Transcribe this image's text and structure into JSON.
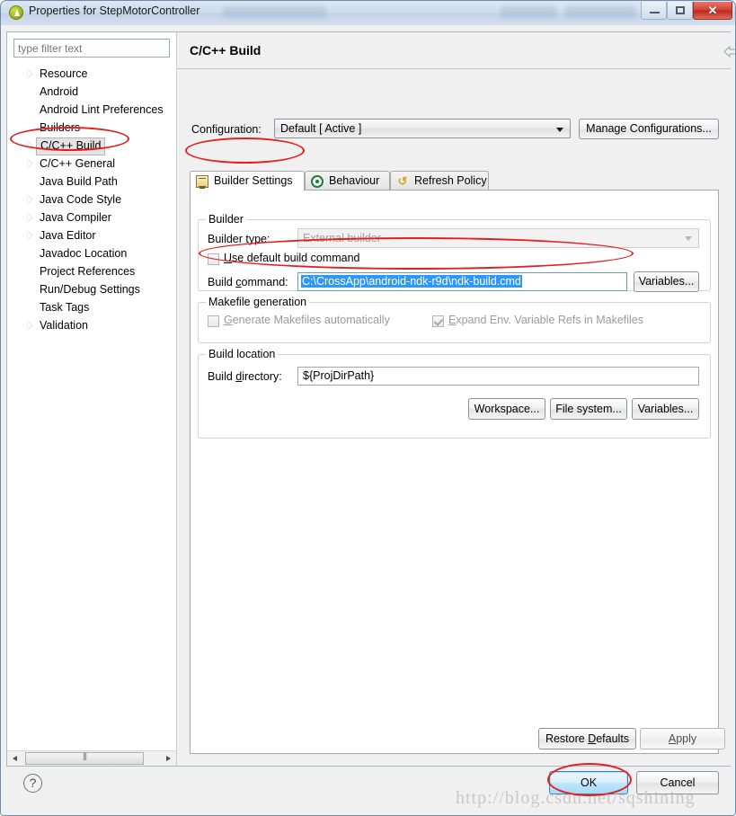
{
  "window": {
    "title": "Properties for StepMotorController",
    "icon": "eclipse-properties-icon",
    "controls": {
      "minimize": "minimize-icon",
      "maximize": "restore-icon",
      "close": "close-icon"
    }
  },
  "sidebar": {
    "filter": {
      "placeholder": "type filter text",
      "value": ""
    },
    "items": [
      {
        "label": "Resource",
        "expandable": true,
        "selected": false
      },
      {
        "label": "Android",
        "expandable": false,
        "selected": false
      },
      {
        "label": "Android Lint Preferences",
        "expandable": false,
        "selected": false
      },
      {
        "label": "Builders",
        "expandable": false,
        "selected": false
      },
      {
        "label": "C/C++ Build",
        "expandable": true,
        "selected": true
      },
      {
        "label": "C/C++ General",
        "expandable": true,
        "selected": false
      },
      {
        "label": "Java Build Path",
        "expandable": false,
        "selected": false
      },
      {
        "label": "Java Code Style",
        "expandable": true,
        "selected": false
      },
      {
        "label": "Java Compiler",
        "expandable": true,
        "selected": false
      },
      {
        "label": "Java Editor",
        "expandable": true,
        "selected": false
      },
      {
        "label": "Javadoc Location",
        "expandable": false,
        "selected": false
      },
      {
        "label": "Project References",
        "expandable": false,
        "selected": false
      },
      {
        "label": "Run/Debug Settings",
        "expandable": false,
        "selected": false
      },
      {
        "label": "Task Tags",
        "expandable": false,
        "selected": false
      },
      {
        "label": "Validation",
        "expandable": true,
        "selected": false
      }
    ]
  },
  "page": {
    "title": "C/C++ Build",
    "nav": {
      "back": "back-arrow-icon",
      "back_menu": "chevron-down-icon",
      "forward": "forward-arrow-icon",
      "forward_menu": "chevron-down-icon",
      "view_menu": "view-menu-icon"
    },
    "configuration": {
      "label": "Configuration:",
      "value": "Default  [ Active ]",
      "manage_button": "Manage Configurations..."
    },
    "tabs": [
      {
        "label": "Builder Settings",
        "icon": "builder-settings-icon",
        "active": true
      },
      {
        "label": "Behaviour",
        "icon": "behaviour-target-icon",
        "active": false
      },
      {
        "label": "Refresh Policy",
        "icon": "refresh-policy-icon",
        "active": false
      }
    ],
    "builder_group": {
      "title": "Builder",
      "builder_type_label": "Builder type:",
      "builder_type_value": "External builder",
      "use_default_label": "Use default build command",
      "use_default_checked": false,
      "build_command_label": "Build command:",
      "build_command_value": "C:\\CrossApp\\android-ndk-r9d\\ndk-build.cmd",
      "build_command_selected": true,
      "variables_button": "Variables..."
    },
    "makefile_group": {
      "title": "Makefile generation",
      "generate_label": "Generate Makefiles automatically",
      "generate_checked": false,
      "expand_env_label": "Expand Env. Variable Refs in Makefiles",
      "expand_env_checked": true
    },
    "build_location_group": {
      "title": "Build location",
      "build_directory_label": "Build directory:",
      "build_directory_value": "${ProjDirPath}",
      "workspace_button": "Workspace...",
      "filesystem_button": "File system...",
      "variables_button": "Variables..."
    },
    "restore_defaults_button": "Restore Defaults",
    "apply_button": "Apply"
  },
  "footer": {
    "help_icon": "?",
    "ok_button": "OK",
    "cancel_button": "Cancel"
  },
  "watermark": "http://blog.csdn.net/sqshining",
  "colors": {
    "annotation_red": "#e31f1f",
    "selection_blue": "#2f97f5",
    "focus_blue": "#3c7fb1"
  }
}
